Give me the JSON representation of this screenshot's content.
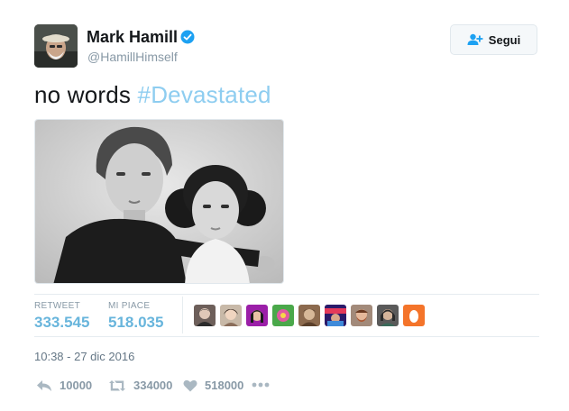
{
  "author": {
    "name": "Mark Hamill",
    "handle": "@HamillHimself",
    "verified": true
  },
  "follow_button": {
    "label": "Segui",
    "icon": "add-user-icon"
  },
  "tweet": {
    "text_prefix": "no words ",
    "hashtag": "#Devastated"
  },
  "stats": {
    "retweets_label": "RETWEET",
    "retweets_value": "333.545",
    "likes_label": "MI PIACE",
    "likes_value": "518.035",
    "likers_count": 9
  },
  "timestamp": "10:38 - 27 dic 2016",
  "actions": {
    "reply_count": "10000",
    "retweet_count": "334000",
    "like_count": "518000",
    "more_icon": "more-dots-icon"
  },
  "colors": {
    "hashtag": "#8ecdf0",
    "stat_value": "#68b5dc",
    "muted": "#8899a6",
    "verified": "#1da1f2"
  }
}
